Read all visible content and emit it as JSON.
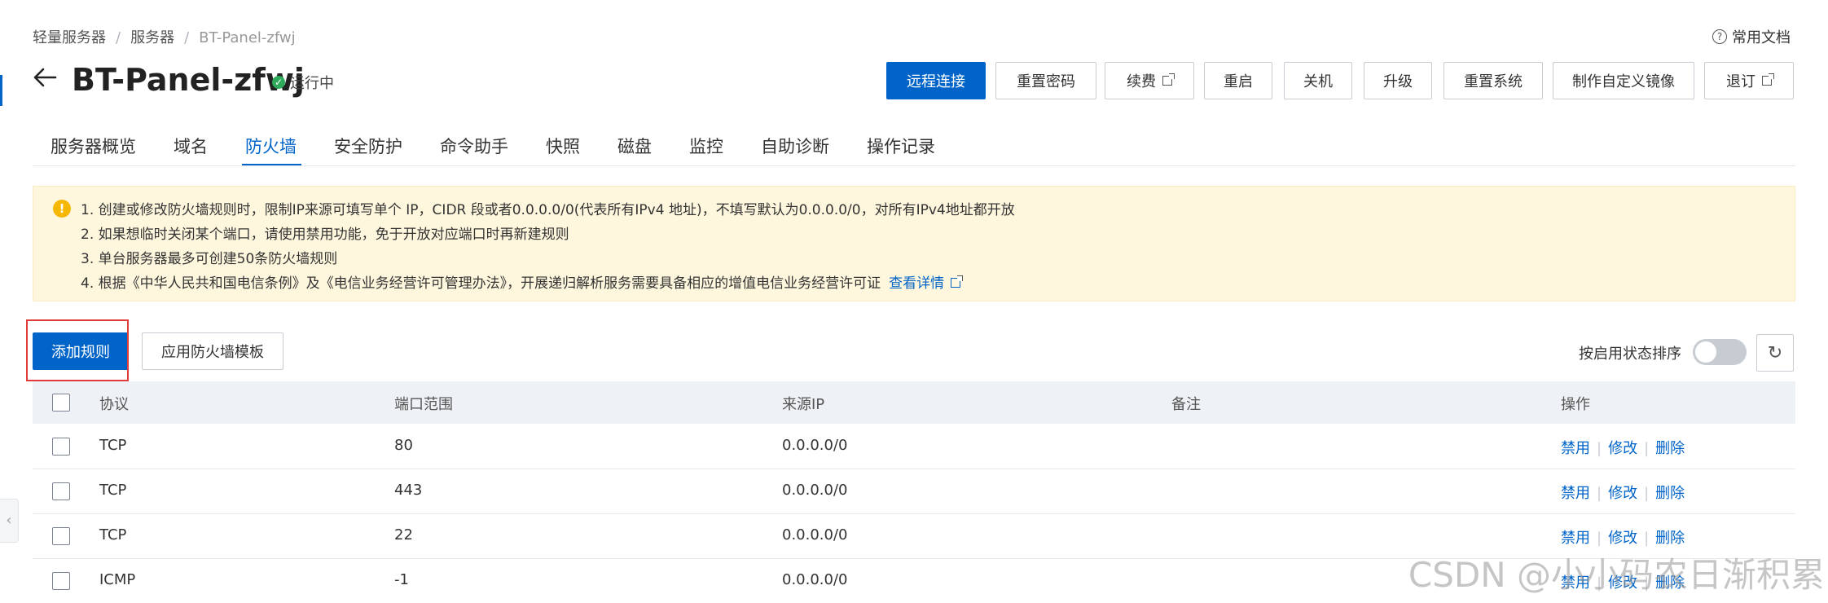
{
  "breadcrumb": [
    "轻量服务器",
    "服务器",
    "BT-Panel-zfwj"
  ],
  "doc_link": "常用文档",
  "server": {
    "name": "BT-Panel-zfwj",
    "status": "运行中"
  },
  "actions": {
    "remote": "远程连接",
    "reset_password": "重置密码",
    "renew": "续费",
    "restart": "重启",
    "shutdown": "关机",
    "upgrade": "升级",
    "reset_system": "重置系统",
    "custom_image": "制作自定义镜像",
    "refund": "退订"
  },
  "tabs": [
    "服务器概览",
    "域名",
    "防火墙",
    "安全防护",
    "命令助手",
    "快照",
    "磁盘",
    "监控",
    "自助诊断",
    "操作记录"
  ],
  "active_tab": "防火墙",
  "notice": {
    "lines": [
      "1. 创建或修改防火墙规则时，限制IP来源可填写单个 IP，CIDR 段或者0.0.0.0/0(代表所有IPv4 地址)，不填写默认为0.0.0.0/0，对所有IPv4地址都开放",
      "2. 如果想临时关闭某个端口，请使用禁用功能，免于开放对应端口时再新建规则",
      "3. 单台服务器最多可创建50条防火墙规则",
      "4. 根据《中华人民共和国电信条例》及《电信业务经营许可管理办法》，开展递归解析服务需要具备相应的增值电信业务经营许可证"
    ],
    "link": "查看详情"
  },
  "toolbar": {
    "add_rule": "添加规则",
    "apply_template": "应用防火墙模板",
    "sort_label": "按启用状态排序"
  },
  "table": {
    "headers": {
      "protocol": "协议",
      "port": "端口范围",
      "source": "来源IP",
      "remark": "备注",
      "ops": "操作"
    },
    "rows": [
      {
        "protocol": "TCP",
        "port": "80",
        "source": "0.0.0.0/0",
        "remark": ""
      },
      {
        "protocol": "TCP",
        "port": "443",
        "source": "0.0.0.0/0",
        "remark": ""
      },
      {
        "protocol": "TCP",
        "port": "22",
        "source": "0.0.0.0/0",
        "remark": ""
      },
      {
        "protocol": "ICMP",
        "port": "-1",
        "source": "0.0.0.0/0",
        "remark": ""
      }
    ],
    "row_ops": {
      "disable": "禁用",
      "edit": "修改",
      "delete": "删除"
    }
  },
  "watermark": "CSDN @小小码农日渐积累",
  "colors": {
    "primary": "#0064c8",
    "notice_bg": "#fff7dd",
    "status_ok": "#2eab5a",
    "highlight": "#e03a3a"
  }
}
